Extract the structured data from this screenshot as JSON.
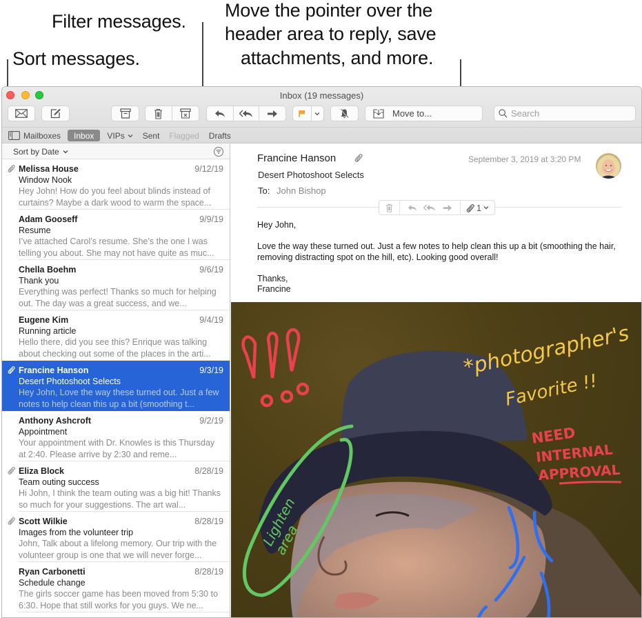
{
  "callouts": {
    "filter": "Filter messages.",
    "sort": "Sort messages.",
    "header_line1": "Move the pointer over the",
    "header_line2": "header area to reply, save",
    "header_line3": "attachments, and more."
  },
  "window": {
    "title": "Inbox (19 messages)"
  },
  "toolbar": {
    "get_mail_icon": "envelope-icon",
    "compose_icon": "compose-icon",
    "archive_icon": "archive-icon",
    "delete_icon": "trash-icon",
    "junk_icon": "junk-icon",
    "reply_icon": "reply-icon",
    "reply_all_icon": "reply-all-icon",
    "forward_icon": "forward-icon",
    "flag_color": "#f5a33a",
    "mute_icon": "bell-slash-icon",
    "move_to_label": "Move to...",
    "search_placeholder": "Search"
  },
  "favorites": [
    {
      "label": "Mailboxes",
      "state": "normal"
    },
    {
      "label": "Inbox",
      "state": "active"
    },
    {
      "label": "VIPs",
      "state": "dropdown"
    },
    {
      "label": "Sent",
      "state": "normal"
    },
    {
      "label": "Flagged",
      "state": "disabled"
    },
    {
      "label": "Drafts",
      "state": "normal"
    }
  ],
  "list": {
    "sort_label": "Sort by Date",
    "messages": [
      {
        "from": "Melissa House",
        "date": "9/12/19",
        "subject": "Window Nook",
        "preview": "Hey John! How do you feel about blinds instead of curtains? Maybe a dark wood to warm the space...",
        "attachment": true,
        "selected": false
      },
      {
        "from": "Adam Gooseff",
        "date": "9/9/19",
        "subject": "Resume",
        "preview": "I’ve attached Carol’s resume. She’s the one I was telling you about. She may not have quite as muc...",
        "attachment": false,
        "selected": false
      },
      {
        "from": "Chella Boehm",
        "date": "9/6/19",
        "subject": "Thank you",
        "preview": "Everything was perfect! Thanks so much for helping out. The day was a great success, and we...",
        "attachment": false,
        "selected": false
      },
      {
        "from": "Eugene Kim",
        "date": "9/4/19",
        "subject": "Running article",
        "preview": "Hello there, did you see this? Enrique was talking about checking out some of the places in the arti...",
        "attachment": false,
        "selected": false
      },
      {
        "from": "Francine Hanson",
        "date": "9/3/19",
        "subject": "Desert Photoshoot Selects",
        "preview": "Hey John, Love the way these turned out. Just a few notes to help clean this up a bit (smoothing t...",
        "attachment": true,
        "selected": true
      },
      {
        "from": "Anthony Ashcroft",
        "date": "9/2/19",
        "subject": "Appointment",
        "preview": "Your appointment with Dr. Knowles is this Thursday at 2:40. Please arrive by 2:30 and reme...",
        "attachment": false,
        "selected": false
      },
      {
        "from": "Eliza Block",
        "date": "8/28/19",
        "subject": "Team outing success",
        "preview": "Hi John, I think the team outing was a big hit! Thanks so much for your suggestions. The art wal...",
        "attachment": true,
        "selected": false
      },
      {
        "from": "Scott Wilkie",
        "date": "8/28/19",
        "subject": "Images from the volunteer trip",
        "preview": "John, Talk about a lifelong memory. Our trip with the volunteer group is one that we will never forge...",
        "attachment": true,
        "selected": false
      },
      {
        "from": "Ryan Carbonetti",
        "date": "8/28/19",
        "subject": "Schedule change",
        "preview": "The girls soccer game has been moved from 5:30 to 6:30. Hope that still works for you guys. We ne...",
        "attachment": false,
        "selected": false
      }
    ]
  },
  "message": {
    "from": "Francine Hanson",
    "subject": "Desert Photoshoot Selects",
    "to_label": "To:",
    "to": "John Bishop",
    "date": "September 3, 2019 at 3:20 PM",
    "attachment_count": "1",
    "body": [
      "Hey John,",
      "Love the way these turned out. Just a few notes to help clean this up a bit (smoothing the hair, removing distracting spot on the hill, etc). Looking good overall!",
      "Thanks,\nFrancine"
    ],
    "annotations": {
      "exclaim": "!!!",
      "photographer_line1": "*photographer's",
      "photographer_line2": "Favorite !!",
      "need_line1": "NEED",
      "need_line2": "INTERNAL",
      "need_line3": "APPROVAL",
      "lighten_line1": "Lighten",
      "lighten_line2": "area",
      "colors": {
        "red": "#e8424e",
        "yellow": "#f4c84a",
        "green": "#63c864",
        "blue": "#2f6ff0"
      }
    }
  }
}
